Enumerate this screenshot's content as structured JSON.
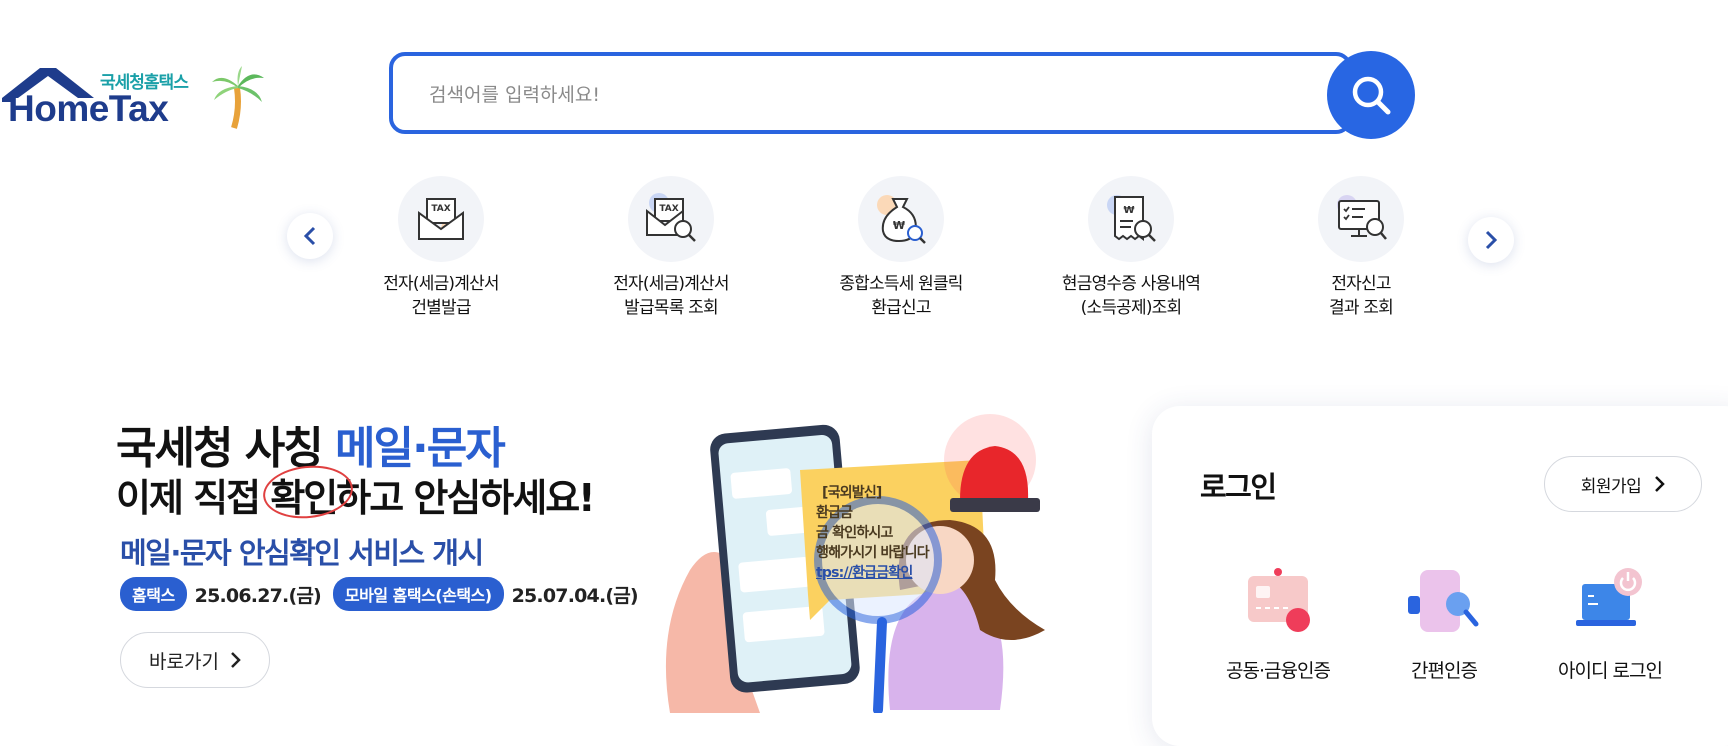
{
  "logo": {
    "korean": "국세청홈택스",
    "english": "HomeTax"
  },
  "search": {
    "placeholder": "검색어를 입력하세요!",
    "value": ""
  },
  "quick_menu": {
    "items": [
      {
        "line1": "전자(세금)계산서",
        "line2": "건별발급",
        "icon": "tax-envelope-icon"
      },
      {
        "line1": "전자(세금)계산서",
        "line2": "발급목록 조회",
        "icon": "tax-search-icon"
      },
      {
        "line1": "종합소득세 원클릭",
        "line2": "환급신고",
        "icon": "money-bag-icon"
      },
      {
        "line1": "현금영수증 사용내역",
        "line2": "(소득공제)조회",
        "icon": "receipt-search-icon"
      },
      {
        "line1": "전자신고",
        "line2": "결과 조회",
        "icon": "monitor-search-icon"
      }
    ]
  },
  "banner": {
    "line1_a": "국세청 사칭 ",
    "line1_b": "메일·문자",
    "line2_a": "이제 직접 ",
    "line2_b": "확인",
    "line2_c": "하고 안심하세요!",
    "line3": "메일·문자 안심확인 서비스 개시",
    "pill1": "홈택스",
    "date1": "25.06.27.(금)",
    "pill2": "모바일 홈택스(손택스)",
    "date2": "25.07.04.(금)",
    "go_label": "바로가기",
    "note_l1": "[국외발신]",
    "note_l2": "환급금 ",
    "note_l3": "금 확인하시고",
    "note_l4": "행해가시기 바랍니다",
    "note_l5": "tps://환급금확인"
  },
  "login": {
    "title": "로그인",
    "join_label": "회원가입",
    "options": [
      {
        "label": "공동·금융인증",
        "icon": "certificate-card-icon"
      },
      {
        "label": "간편인증",
        "icon": "simple-auth-icon"
      },
      {
        "label": "아이디 로그인",
        "icon": "id-login-laptop-icon"
      }
    ]
  },
  "colors": {
    "primary": "#2866e3",
    "banner_blue": "#2a5fd0",
    "logo_navy": "#1e3c8c",
    "logo_teal": "#1aa0a8"
  }
}
